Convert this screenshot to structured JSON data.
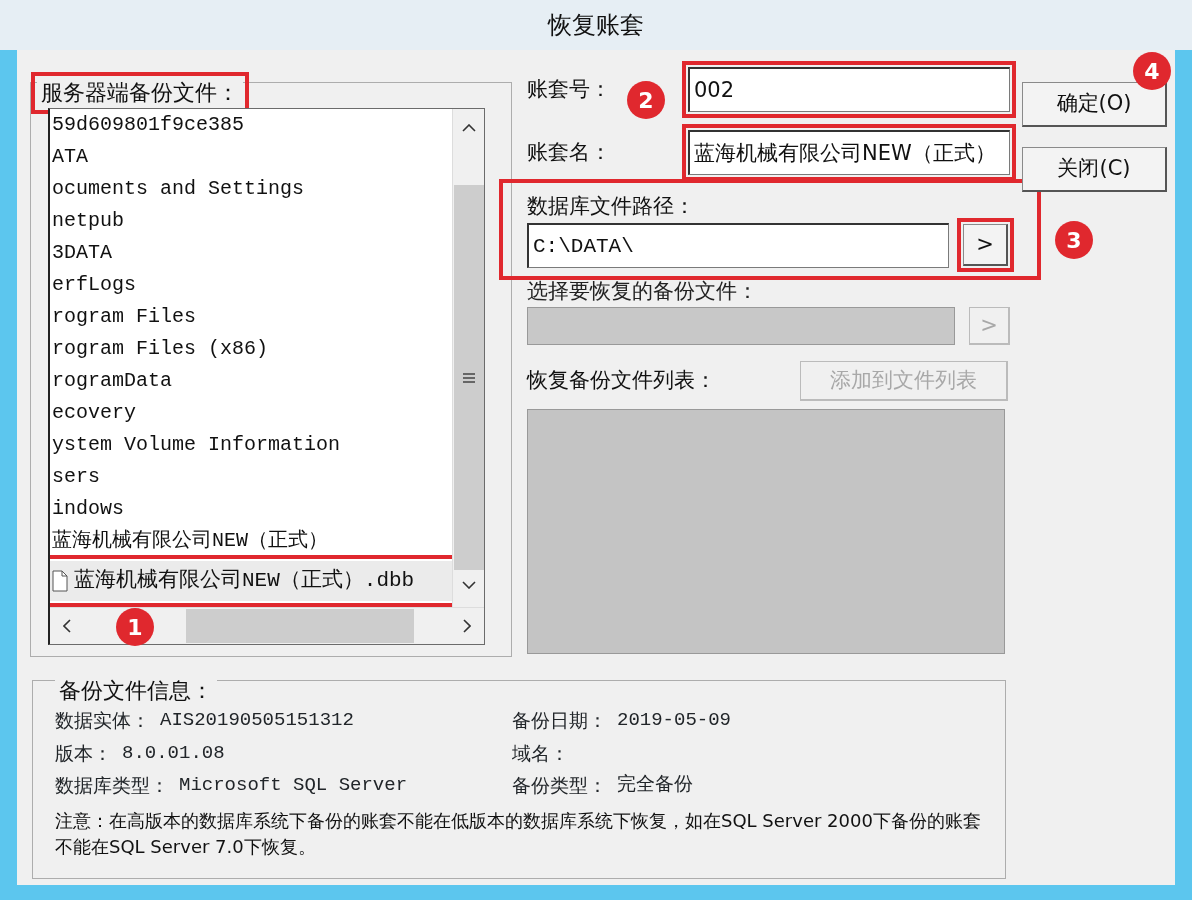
{
  "window": {
    "title": "恢复账套"
  },
  "server_files": {
    "legend": "服务器端备份文件：",
    "highlighted": true,
    "items": [
      {
        "text": "59d609801f9ce385",
        "kind": "folder",
        "selected": false
      },
      {
        "text": "ATA",
        "kind": "folder",
        "selected": false
      },
      {
        "text": "ocuments and Settings",
        "kind": "folder",
        "selected": false
      },
      {
        "text": "netpub",
        "kind": "folder",
        "selected": false
      },
      {
        "text": "3DATA",
        "kind": "folder",
        "selected": false
      },
      {
        "text": "erfLogs",
        "kind": "folder",
        "selected": false
      },
      {
        "text": "rogram Files",
        "kind": "folder",
        "selected": false
      },
      {
        "text": "rogram Files (x86)",
        "kind": "folder",
        "selected": false
      },
      {
        "text": "rogramData",
        "kind": "folder",
        "selected": false
      },
      {
        "text": "ecovery",
        "kind": "folder",
        "selected": false
      },
      {
        "text": "ystem Volume Information",
        "kind": "folder",
        "selected": false
      },
      {
        "text": "sers",
        "kind": "folder",
        "selected": false
      },
      {
        "text": "indows",
        "kind": "folder",
        "selected": false
      },
      {
        "text": "蓝海机械有限公司NEW（正式）",
        "kind": "folder",
        "selected": false
      },
      {
        "text": "蓝海机械有限公司NEW（正式）.dbb",
        "kind": "file",
        "selected": true,
        "highlighted": true,
        "badge": "1"
      }
    ]
  },
  "account_no": {
    "label": "账套号：",
    "value": "002",
    "highlighted": true,
    "badge": "2"
  },
  "account_name": {
    "label": "账套名：",
    "value": "蓝海机械有限公司NEW（正式）",
    "highlighted": true
  },
  "db_path": {
    "label": "数据库文件路径：",
    "value": "C:\\DATA\\",
    "highlighted": true,
    "button": {
      "text": ">",
      "disabled": false,
      "highlighted": true,
      "badge": "3"
    }
  },
  "backup_file": {
    "label": "选择要恢复的备份文件：",
    "disabled": true,
    "button": {
      "text": ">",
      "disabled": true
    }
  },
  "restore_list": {
    "label": "恢复备份文件列表：",
    "add_button": {
      "text": "添加到文件列表",
      "disabled": true
    }
  },
  "buttons": [
    {
      "text": "确定(O)",
      "badge": "4"
    },
    {
      "text": "关闭(C)"
    }
  ],
  "info": {
    "legend": "备份文件信息：",
    "fields": [
      {
        "label": "数据实体：",
        "value": "AIS20190505151312"
      },
      {
        "label": "备份日期：",
        "value": "2019-05-09"
      },
      {
        "label": "版本：",
        "value": "8.0.01.08"
      },
      {
        "label": "域名："
      },
      {
        "label": "数据库类型：",
        "value": "Microsoft SQL Server"
      },
      {
        "label": "备份类型：",
        "value": "完全备份"
      }
    ],
    "note": "注意：在高版本的数据库系统下备份的账套不能在低版本的数据库系统下恢复，如在SQL Server 2000下备份的账套不能在SQL Server 7.0下恢复。"
  }
}
